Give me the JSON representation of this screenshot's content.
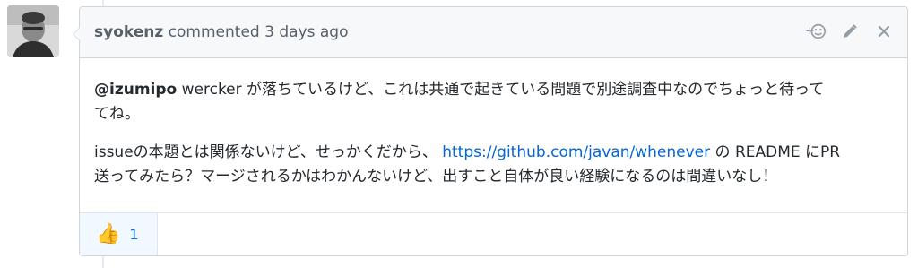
{
  "comment": {
    "author": "syokenz",
    "action_text": "commented",
    "timestamp": "3 days ago",
    "body": {
      "para1_mention": "@izumipo",
      "para1_text": " wercker が落ちているけど、これは共通で起きている問題で別途調査中なのでちょっと待って",
      "para1_text2": "てね。",
      "para2_text_before": "issueの本題とは関係ないけど、せっかくだから、 ",
      "para2_link": "https://github.com/javan/whenever",
      "para2_text_after": " の README にPR",
      "para2_text_line2": "送ってみたら？マージされるかはわかんないけど、出すこと自体が良い経験になるのは間違いなし！"
    },
    "reactions": [
      {
        "icon": "thumbs-up-icon",
        "emoji": "👍",
        "count": "1"
      }
    ]
  },
  "colors": {
    "link": "#0366d6",
    "header_bg": "#f6f8fa",
    "border": "#d1d5da",
    "reaction_bg": "#f1f8ff"
  }
}
